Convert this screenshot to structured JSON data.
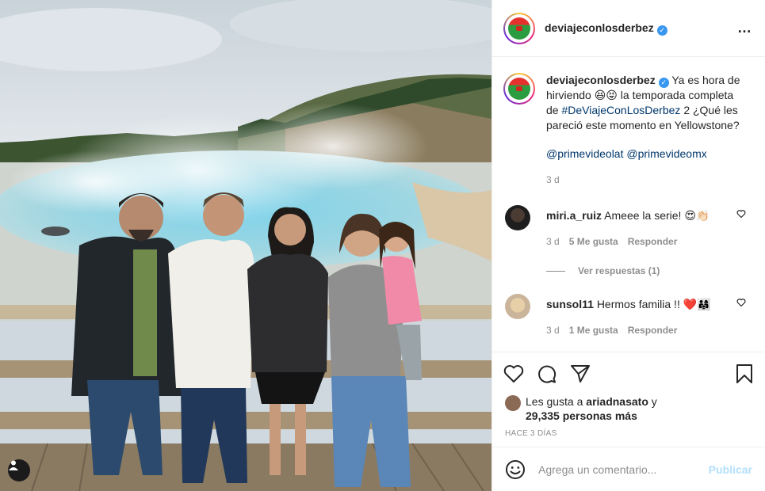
{
  "post": {
    "username": "deviajeconlosderbez",
    "more_icon": "…",
    "caption": {
      "text_a": "Ya es hora de hirviendo 😆😝 la temporada completa de",
      "hashtag": "#DeViajeConLosDerbez",
      "text_b": "2 ¿Qué les pareció este momento en Yellowstone?",
      "mention_1": "@primevideolat",
      "mention_2": "@primevideomx",
      "time": "3 d"
    },
    "comments": [
      {
        "username": "miri.a_ruiz",
        "text": "Ameee la serie! 😍👏🏻",
        "time": "3 d",
        "likes": "5 Me gusta",
        "reply": "Responder",
        "view_replies": "Ver respuestas (1)"
      },
      {
        "username": "sunsol11",
        "text": "Hermos familia !! ❤️👨‍👩‍👧",
        "time": "3 d",
        "likes": "1 Me gusta",
        "reply": "Responder"
      }
    ],
    "likes": {
      "prefix": "Les gusta a",
      "user": "ariadnasato",
      "conj": "y",
      "count": "29,335 personas más"
    },
    "ago": "HACE 3 DÍAS",
    "add_comment": {
      "placeholder": "Agrega un comentario...",
      "publish": "Publicar"
    }
  },
  "colors": {
    "accent": "#3897f0",
    "link": "#00376b",
    "muted": "#8e8e8e",
    "publish_disabled": "#b2dffc"
  }
}
